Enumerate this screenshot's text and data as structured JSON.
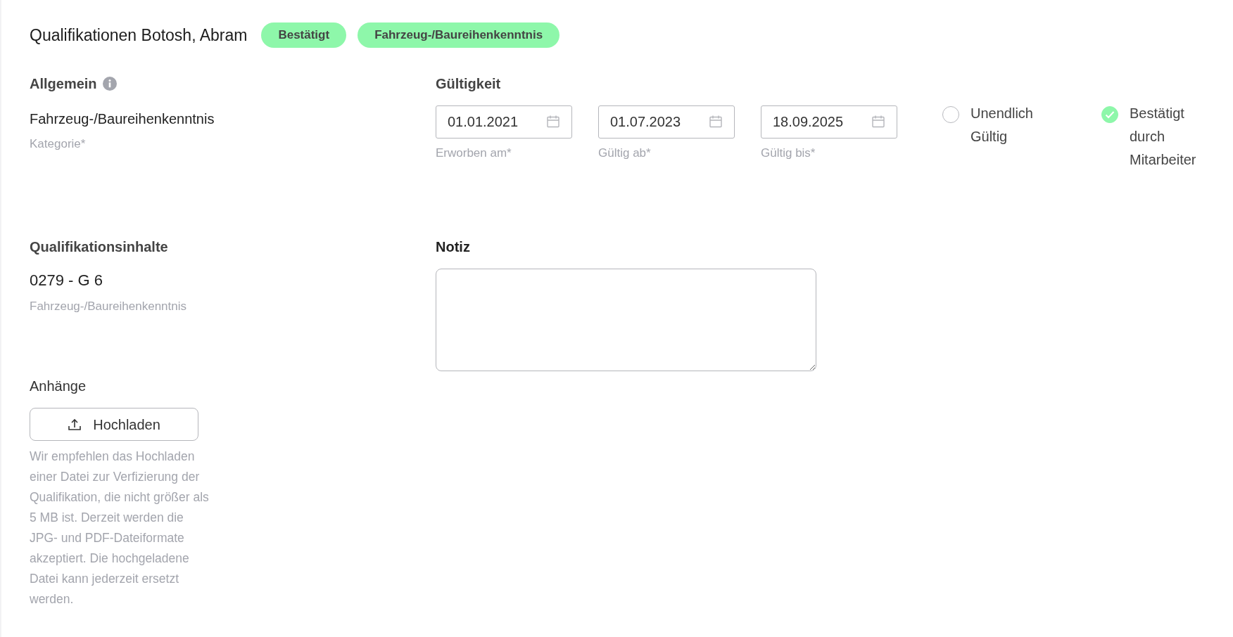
{
  "header": {
    "title": "Qualifikationen Botosh, Abram",
    "badges": [
      "Bestätigt",
      "Fahrzeug-/Baureihenkenntnis"
    ]
  },
  "general": {
    "heading": "Allgemein",
    "value": "Fahrzeug-/Baureihenkenntnis",
    "label": "Kategorie*"
  },
  "validity": {
    "heading": "Gültigkeit",
    "dates": [
      {
        "value": "01.01.2021",
        "label": "Erworben am*"
      },
      {
        "value": "01.07.2023",
        "label": "Gültig ab*"
      },
      {
        "value": "18.09.2025",
        "label": "Gültig bis*"
      }
    ],
    "checkboxes": [
      {
        "label": "Unendlich Gültig",
        "checked": false
      },
      {
        "label": "Bestätigt durch Mitarbeiter",
        "checked": true
      }
    ]
  },
  "contents": {
    "heading": "Qualifikationsinhalte",
    "value": "0279 - G 6",
    "label": "Fahrzeug-/Baureihenkenntnis"
  },
  "note": {
    "heading": "Notiz"
  },
  "attachments": {
    "heading": "Anhänge",
    "button": "Hochladen",
    "help": "Wir empfehlen das Hochladen einer Datei zur Verfizierung der Qualifikation, die nicht größer als 5 MB ist. Derzeit werden die JPG- und PDF-Dateiformate akzeptiert. Die hochgeladene Datei kann jederzeit ersetzt werden."
  }
}
